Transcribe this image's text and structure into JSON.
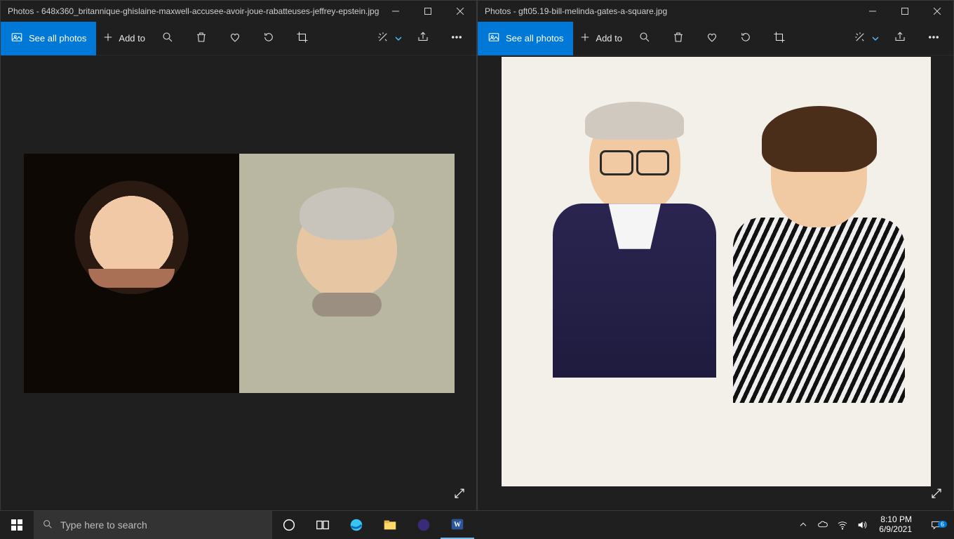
{
  "windows": [
    {
      "title": "Photos - 648x360_britannique-ghislaine-maxwell-accusee-avoir-joue-rabatteuses-jeffrey-epstein.jpg",
      "see_all_label": "See all photos",
      "add_to_label": "Add to"
    },
    {
      "title": "Photos - gft05.19-bill-melinda-gates-a-square.jpg",
      "see_all_label": "See all photos",
      "add_to_label": "Add to"
    }
  ],
  "taskbar": {
    "search_placeholder": "Type here to search",
    "clock_time": "8:10 PM",
    "clock_date": "6/9/2021",
    "notification_count": "6"
  }
}
